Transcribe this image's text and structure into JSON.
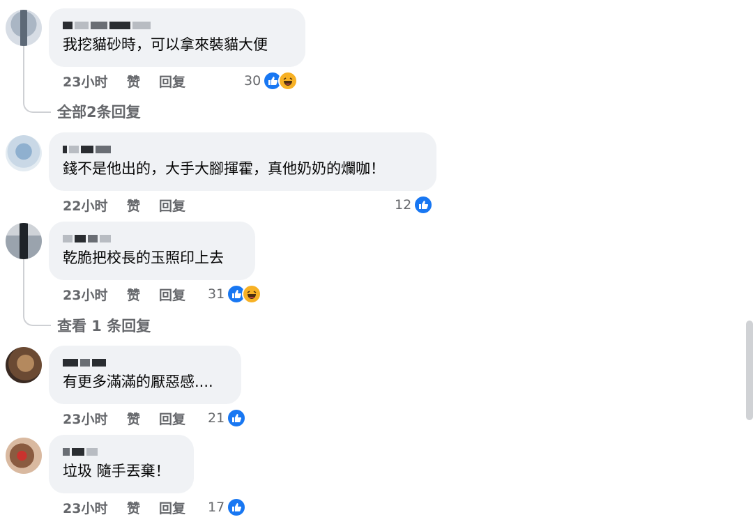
{
  "comments": [
    {
      "text": "我挖貓砂時，可以拿來裝貓大便",
      "time": "23小时",
      "like_label": "赞",
      "reply_label": "回复",
      "reaction_count": "30",
      "reactions": [
        "like-icon",
        "haha-icon"
      ],
      "replies_link": "全部2条回复"
    },
    {
      "text": "錢不是他出的，大手大腳揮霍，真他奶奶的爛咖！",
      "time": "22小时",
      "like_label": "赞",
      "reply_label": "回复",
      "reaction_count": "12",
      "reactions": [
        "like-icon"
      ]
    },
    {
      "text": "乾脆把校長的玉照印上去",
      "time": "23小时",
      "like_label": "赞",
      "reply_label": "回复",
      "reaction_count": "31",
      "reactions": [
        "like-icon",
        "haha-icon"
      ],
      "replies_link": "查看 1 条回复"
    },
    {
      "text": "有更多滿滿的厭惡感....",
      "time": "23小时",
      "like_label": "赞",
      "reply_label": "回复",
      "reaction_count": "21",
      "reactions": [
        "like-icon"
      ]
    },
    {
      "text": "垃圾 隨手丟棄！",
      "time": "23小时",
      "like_label": "赞",
      "reply_label": "回复",
      "reaction_count": "17",
      "reactions": [
        "like-icon"
      ]
    }
  ],
  "colors": {
    "bubble": "#f0f2f5",
    "meta_text": "#65676b",
    "like_blue": "#1877f2",
    "haha_yellow": "#f7b125"
  }
}
